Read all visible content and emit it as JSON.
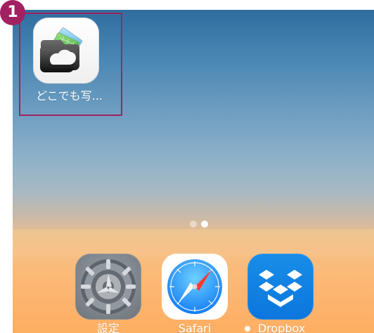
{
  "annotation": {
    "step_number": "1"
  },
  "home_screen": {
    "featured_app": {
      "label": "どこでも写...",
      "icon": "photo-cloud-folder-icon"
    },
    "page_indicator": {
      "count": 2,
      "active_index": 1
    }
  },
  "dock": {
    "apps": [
      {
        "label": "設定",
        "icon": "settings-icon"
      },
      {
        "label": "Safari",
        "icon": "safari-icon"
      },
      {
        "label": "Dropbox",
        "icon": "dropbox-icon",
        "status_dot": true
      }
    ]
  },
  "colors": {
    "annotation_accent": "#a22160",
    "dock_tint": "#ffbf72",
    "dropbox_blue": "#0f7de2",
    "safari_blue": "#2fa3ff"
  }
}
